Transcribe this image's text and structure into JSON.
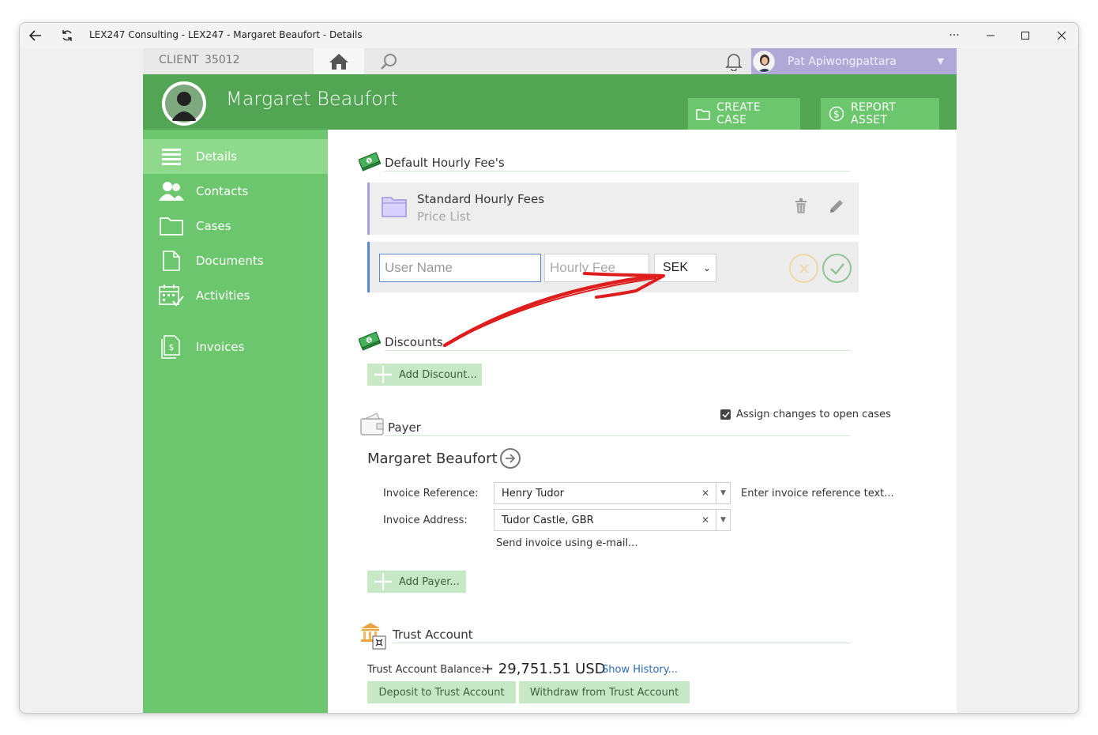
{
  "window": {
    "title": "LEX247 Consulting - LEX247 - Margaret Beaufort - Details"
  },
  "topbar": {
    "client_label": "CLIENT",
    "client_id": "35012",
    "user_name": "Pat Apiwongpattara"
  },
  "header": {
    "client_name": "Margaret Beaufort",
    "create_case_label": "CREATE CASE",
    "report_asset_label": "REPORT ASSET"
  },
  "sidebar": {
    "items": [
      {
        "label": "Details",
        "icon": "list-icon",
        "active": true
      },
      {
        "label": "Contacts",
        "icon": "people-icon",
        "active": false
      },
      {
        "label": "Cases",
        "icon": "folder-icon",
        "active": false
      },
      {
        "label": "Documents",
        "icon": "document-icon",
        "active": false
      },
      {
        "label": "Activities",
        "icon": "calendar-check-icon",
        "active": false
      },
      {
        "label": "Invoices",
        "icon": "invoice-icon",
        "active": false
      }
    ]
  },
  "fees": {
    "title": "Default Hourly Fee's",
    "price_list_name": "Standard Hourly Fees",
    "price_list_type": "Price List",
    "user_placeholder": "User Name",
    "fee_placeholder": "Hourly Fee",
    "currency": "SEK"
  },
  "discounts": {
    "title": "Discounts",
    "add_label": "Add Discount..."
  },
  "payer": {
    "title": "Payer",
    "assign_label": "Assign changes to open cases",
    "assign_checked": true,
    "name": "Margaret Beaufort",
    "invoice_reference_label": "Invoice Reference:",
    "invoice_reference_value": "Henry Tudor",
    "invoice_reference_hint": "Enter invoice reference text...",
    "invoice_address_label": "Invoice Address:",
    "invoice_address_value": "Tudor Castle, GBR",
    "send_email_label": "Send invoice using e-mail...",
    "add_label": "Add Payer..."
  },
  "trust": {
    "title": "Trust Account",
    "balance_label": "Trust Account Balance:",
    "balance_value": "+ 29,751.51 USD",
    "history_label": "Show History...",
    "deposit_label": "Deposit to Trust Account",
    "withdraw_label": "Withdraw from Trust Account"
  },
  "colors": {
    "header_green": "#52a653",
    "sidebar_green": "#6cc66d",
    "active_green": "#8ed98c",
    "user_purple": "#b0a9d8",
    "link_blue": "#2f6db5",
    "annotation_red": "#e01d1d"
  }
}
